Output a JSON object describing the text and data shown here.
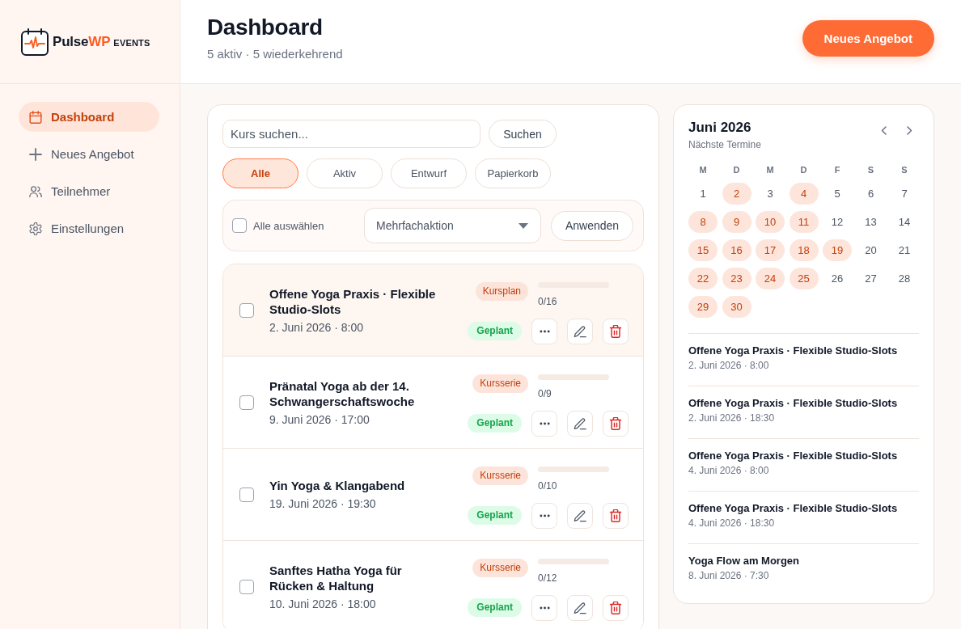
{
  "sidebar": {
    "logo": {
      "name": "Pulse",
      "name_accent": "WP",
      "tagline": "EVENTS"
    },
    "items": [
      {
        "label": "Dashboard",
        "selected": true
      },
      {
        "label": "Neues Angebot",
        "selected": false
      },
      {
        "label": "Teilnehmer",
        "selected": false
      },
      {
        "label": "Einstellungen",
        "selected": false
      }
    ]
  },
  "header": {
    "title": "Dashboard",
    "subtitle": "5 aktiv · 5 wiederkehrend",
    "primary_button": "Neues Angebot"
  },
  "course_list": {
    "search": {
      "placeholder": "Kurs suchen...",
      "button": "Suchen"
    },
    "filters": [
      {
        "label": "Alle",
        "selected": true
      },
      {
        "label": "Aktiv",
        "selected": false
      },
      {
        "label": "Entwurf",
        "selected": false
      },
      {
        "label": "Papierkorb",
        "selected": false
      }
    ],
    "bulk_actions": {
      "select_all": {
        "label": "Alle auswählen",
        "checked": false
      },
      "action_select": {
        "value": "Mehrfachaktion"
      },
      "apply_button": "Anwenden"
    },
    "courses": [
      {
        "title": "Offene Yoga Praxis · Flexible Studio-Slots",
        "date": "2. Juni 2026 · 8:00",
        "type": "Kursplan",
        "status": "Geplant",
        "booked": "0/16",
        "level": 0,
        "checked": false,
        "highlighted": true
      },
      {
        "title": "Pränatal Yoga ab der 14. Schwangerschaftswoche",
        "date": "9. Juni 2026 · 17:00",
        "type": "Kursserie",
        "status": "Geplant",
        "booked": "0/9",
        "level": 0,
        "checked": false,
        "highlighted": false
      },
      {
        "title": "Yin Yoga & Klangabend",
        "date": "19. Juni 2026 · 19:30",
        "type": "Kursserie",
        "status": "Geplant",
        "booked": "0/10",
        "level": 0,
        "checked": false,
        "highlighted": false
      },
      {
        "title": "Sanftes Hatha Yoga für Rücken & Haltung",
        "date": "10. Juni 2026 · 18:00",
        "type": "Kursserie",
        "status": "Geplant",
        "booked": "0/12",
        "level": 0,
        "checked": false,
        "highlighted": false
      }
    ]
  },
  "calendar": {
    "title": "Juni 2026",
    "subtitle": "Nächste Termine",
    "weekdays": [
      "M",
      "D",
      "M",
      "D",
      "F",
      "S",
      "S"
    ],
    "days": [
      {
        "day": "1",
        "has_events": false
      },
      {
        "day": "2",
        "has_events": true
      },
      {
        "day": "3",
        "has_events": false
      },
      {
        "day": "4",
        "has_events": true
      },
      {
        "day": "5",
        "has_events": false
      },
      {
        "day": "6",
        "has_events": false
      },
      {
        "day": "7",
        "has_events": false
      },
      {
        "day": "8",
        "has_events": true
      },
      {
        "day": "9",
        "has_events": true
      },
      {
        "day": "10",
        "has_events": true
      },
      {
        "day": "11",
        "has_events": true
      },
      {
        "day": "12",
        "has_events": false
      },
      {
        "day": "13",
        "has_events": false
      },
      {
        "day": "14",
        "has_events": false
      },
      {
        "day": "15",
        "has_events": true
      },
      {
        "day": "16",
        "has_events": true
      },
      {
        "day": "17",
        "has_events": true
      },
      {
        "day": "18",
        "has_events": true
      },
      {
        "day": "19",
        "has_events": true
      },
      {
        "day": "20",
        "has_events": false
      },
      {
        "day": "21",
        "has_events": false
      },
      {
        "day": "22",
        "has_events": true
      },
      {
        "day": "23",
        "has_events": true
      },
      {
        "day": "24",
        "has_events": true
      },
      {
        "day": "25",
        "has_events": true
      },
      {
        "day": "26",
        "has_events": false
      },
      {
        "day": "27",
        "has_events": false
      },
      {
        "day": "28",
        "has_events": false
      },
      {
        "day": "29",
        "has_events": true
      },
      {
        "day": "30",
        "has_events": true
      }
    ],
    "upcoming": [
      {
        "title": "Offene Yoga Praxis · Flexible Studio-Slots",
        "date": "2. Juni 2026 · 8:00"
      },
      {
        "title": "Offene Yoga Praxis · Flexible Studio-Slots",
        "date": "2. Juni 2026 · 18:30"
      },
      {
        "title": "Offene Yoga Praxis · Flexible Studio-Slots",
        "date": "4. Juni 2026 · 8:00"
      },
      {
        "title": "Offene Yoga Praxis · Flexible Studio-Slots",
        "date": "4. Juni 2026 · 18:30"
      },
      {
        "title": "Yoga Flow am Morgen",
        "date": "8. Juni 2026 · 7:30"
      }
    ]
  }
}
